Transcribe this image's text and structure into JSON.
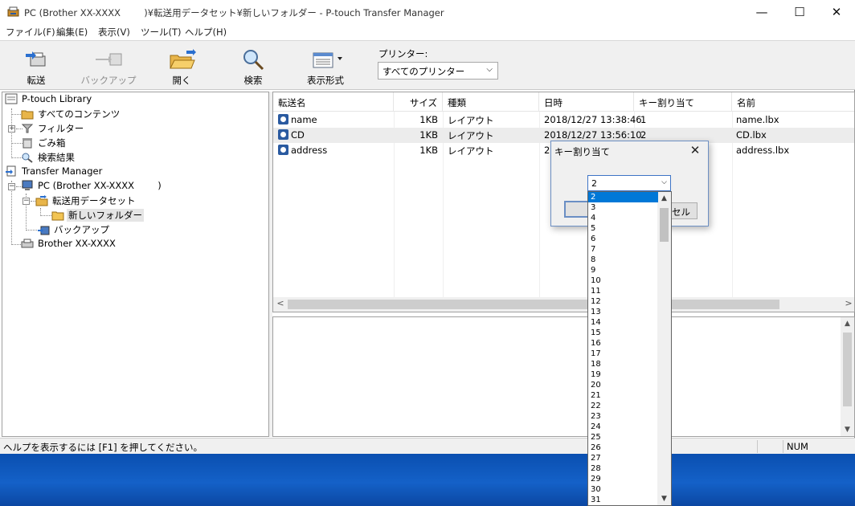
{
  "window": {
    "title": "PC (Brother XX-XXXX        )¥転送用データセット¥新しいフォルダー - P-touch Transfer Manager",
    "minimize": "—",
    "maximize": "☐",
    "close": "✕"
  },
  "menu": [
    "ファイル(F)",
    "編集(E)",
    "表示(V)",
    "ツール(T)",
    "ヘルプ(H)"
  ],
  "toolbar": {
    "transfer": "転送",
    "backup": "バックアップ",
    "open": "開く",
    "search": "検索",
    "view": "表示形式",
    "printer_label": "プリンター:",
    "printer_value": "すべてのプリンター",
    "printer_chevron": "⌵"
  },
  "tree": {
    "library": "P-touch Library",
    "all_contents": "すべてのコンテンツ",
    "filter": "フィルター",
    "trash": "ごみ箱",
    "search_results": "検索結果",
    "transfer_manager": "Transfer Manager",
    "pc": "PC (Brother XX-XXXX        )",
    "dataset": "転送用データセット",
    "new_folder": "新しいフォルダー",
    "backup": "バックアップ",
    "brother": "Brother  XX-XXXX"
  },
  "list": {
    "columns": [
      "転送名",
      "サイズ",
      "種類",
      "日時",
      "キー割り当て",
      "名前"
    ],
    "rows": [
      {
        "name": "name",
        "size": "1KB",
        "type": "レイアウト",
        "date": "2018/12/27 13:38:46",
        "key": "1",
        "file": "name.lbx"
      },
      {
        "name": "CD",
        "size": "1KB",
        "type": "レイアウト",
        "date": "2018/12/27 13:56:10",
        "key": "2",
        "file": "CD.lbx"
      },
      {
        "name": "address",
        "size": "1KB",
        "type": "レイアウト",
        "date": "20",
        "key": "",
        "file": "address.lbx"
      }
    ]
  },
  "status": {
    "help_text": "ヘルプを表示するには [F1] を押してください。",
    "num": "NUM"
  },
  "dialog": {
    "title": "キー割り当て",
    "close": "✕",
    "cancel_fragment": "セル",
    "combo_value": "2",
    "combo_chevron": "⌵",
    "options": [
      "2",
      "3",
      "4",
      "5",
      "6",
      "7",
      "8",
      "9",
      "10",
      "11",
      "12",
      "13",
      "14",
      "15",
      "16",
      "17",
      "18",
      "19",
      "20",
      "21",
      "22",
      "23",
      "24",
      "25",
      "26",
      "27",
      "28",
      "29",
      "30",
      "31"
    ],
    "selected": "2",
    "scroll_up": "▲",
    "scroll_down": "▼"
  },
  "scroll": {
    "left": "<",
    "right": ">",
    "up": "▲",
    "down": "▼"
  },
  "colors": {
    "selection": "#0078d7",
    "desktop": "#0d4ea8",
    "row_highlight": "#ececec"
  }
}
